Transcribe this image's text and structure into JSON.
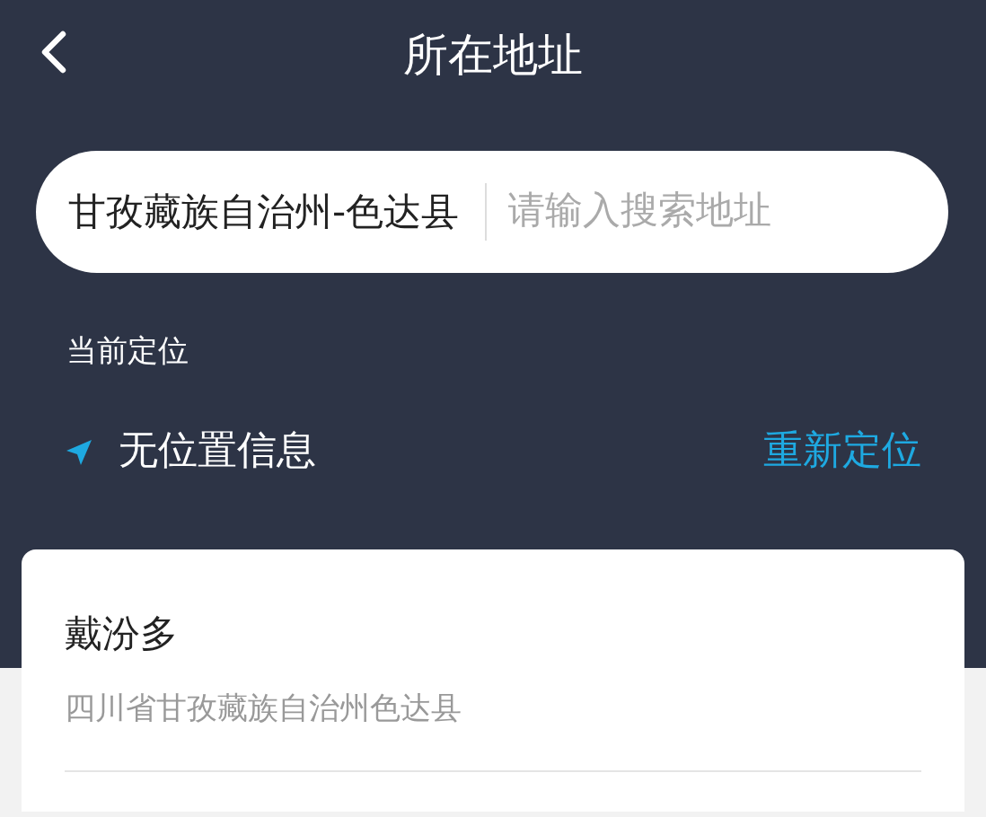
{
  "header": {
    "title": "所在地址"
  },
  "search": {
    "region": "甘孜藏族自治州-色达县",
    "placeholder": "请输入搜索地址"
  },
  "current_location": {
    "label": "当前定位",
    "text": "无位置信息",
    "action": "重新定位"
  },
  "results": [
    {
      "name": "戴汾多",
      "address": "四川省甘孜藏族自治州色达县"
    }
  ]
}
